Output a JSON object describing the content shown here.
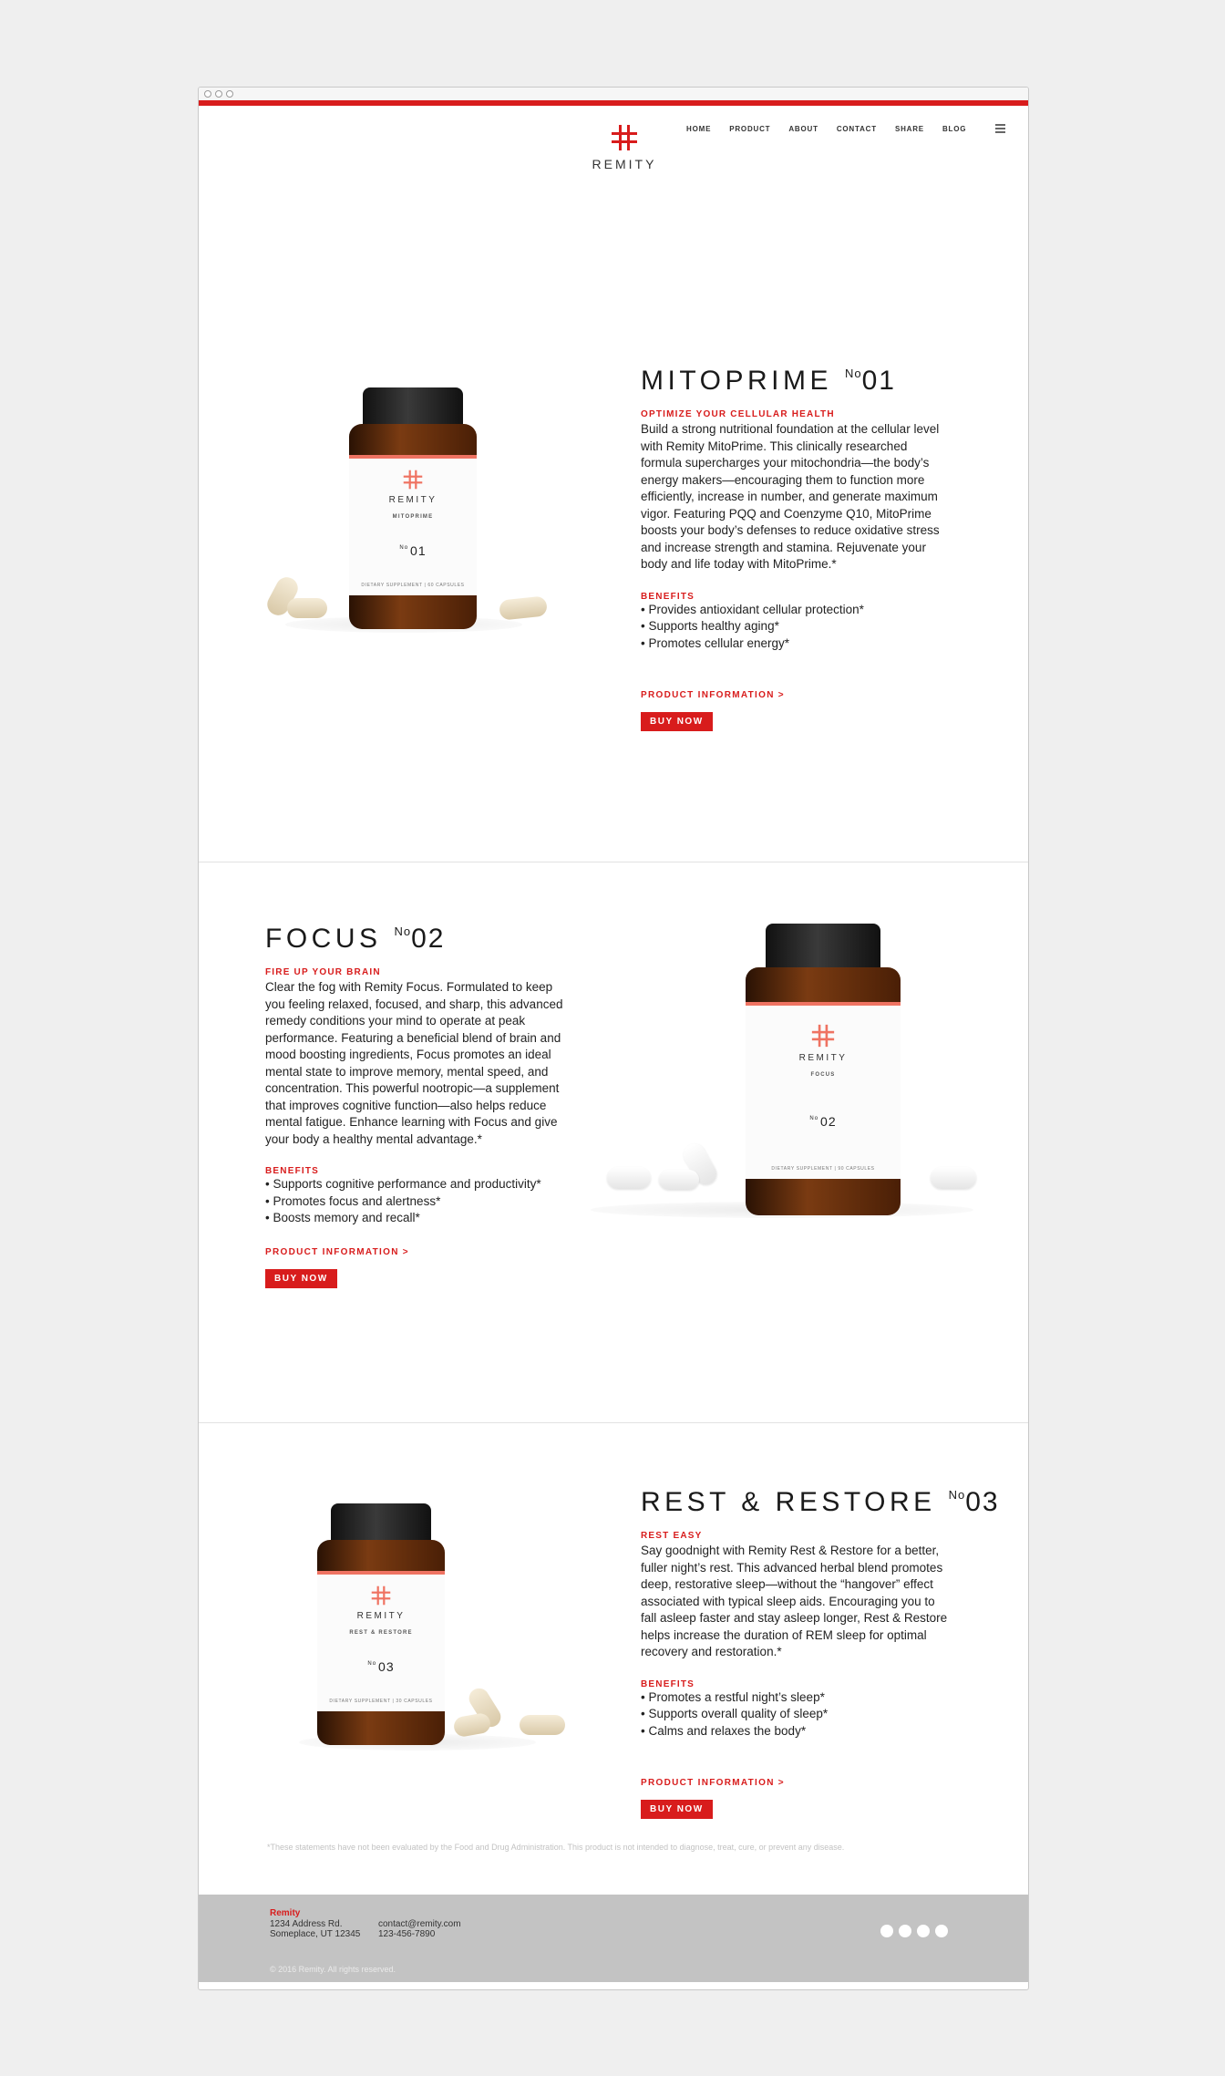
{
  "brand": {
    "name": "REMITY",
    "accent": "#d81c1c",
    "label_accent": "#ef7362"
  },
  "nav": {
    "items": [
      "HOME",
      "PRODUCT",
      "ABOUT",
      "CONTACT",
      "SHARE",
      "BLOG"
    ],
    "menu_icon": "hamburger-icon"
  },
  "products": [
    {
      "name": "MITOPRIME",
      "no_prefix": "No",
      "number": "01",
      "tagline": "OPTIMIZE YOUR CELLULAR HEALTH",
      "description": "Build a strong nutritional foundation at the cellular level with Remity MitoPrime. This clinically researched formula supercharges your mitochondria—the body’s energy makers—encouraging them to function more efficiently, increase in number, and generate maximum vigor. Featuring PQQ and Coenzyme Q10, MitoPrime boosts your body’s defenses to reduce oxidative stress and increase strength and stamina. Rejuvenate your body and life today with MitoPrime.*",
      "benefits_heading": "BENEFITS",
      "benefits": [
        "• Provides antioxidant cellular protection*",
        "• Supports healthy aging*",
        "• Promotes cellular energy*"
      ],
      "product_info_link": "PRODUCT INFORMATION >",
      "buy_label": "BUY NOW",
      "bottle": {
        "brand": "REMITY",
        "product": "MITOPRIME",
        "no": "No",
        "number": "01",
        "fine": "DIETARY SUPPLEMENT | 60 CAPSULES"
      }
    },
    {
      "name": "FOCUS",
      "no_prefix": "No",
      "number": "02",
      "tagline": "FIRE UP YOUR BRAIN",
      "description": "Clear the fog with Remity Focus. Formulated to keep you feeling relaxed, focused, and sharp, this advanced remedy conditions your mind to operate at peak performance. Featuring a beneficial blend of brain and mood boosting ingredients, Focus promotes an ideal mental state to improve memory, mental speed, and concentration. This powerful nootropic—a supplement that improves cognitive function—also helps reduce mental fatigue. Enhance learning with Focus and give your body a healthy mental advantage.*",
      "benefits_heading": "BENEFITS",
      "benefits": [
        "• Supports cognitive performance and productivity*",
        "• Promotes focus and alertness*",
        "• Boosts memory and recall*"
      ],
      "product_info_link": "PRODUCT INFORMATION >",
      "buy_label": "BUY NOW",
      "bottle": {
        "brand": "REMITY",
        "product": "FOCUS",
        "no": "No",
        "number": "02",
        "fine": "DIETARY SUPPLEMENT | 90 CAPSULES"
      }
    },
    {
      "name": "REST & RESTORE",
      "no_prefix": "No",
      "number": "03",
      "tagline": "REST EASY",
      "description": "Say goodnight with Remity Rest & Restore for a better, fuller night’s rest. This advanced herbal blend promotes deep, restorative sleep—without the “hangover” effect associated with typical sleep aids. Encouraging you to fall asleep faster and stay asleep longer, Rest & Restore helps increase the duration of REM sleep for optimal recovery and restoration.*",
      "benefits_heading": "BENEFITS",
      "benefits": [
        "• Promotes a restful night’s sleep*",
        "• Supports overall quality of sleep*",
        "• Calms and relaxes the body*"
      ],
      "product_info_link": "PRODUCT INFORMATION >",
      "buy_label": "BUY NOW",
      "bottle": {
        "brand": "REMITY",
        "product": "REST & RESTORE",
        "no": "No",
        "number": "03",
        "fine": "DIETARY SUPPLEMENT | 30 CAPSULES"
      }
    }
  ],
  "disclaimer": "*These statements have not been evaluated by the Food and Drug Administration. This product is not intended to diagnose, treat, cure, or prevent any disease.",
  "footer": {
    "brand": "Remity",
    "address_line1": "1234 Address Rd.",
    "address_line2": "Someplace, UT 12345",
    "email": "contact@remity.com",
    "phone": "123-456-7890",
    "copyright": "© 2016 Remity. All rights reserved.",
    "social_icons": [
      "social-icon-1",
      "social-icon-2",
      "social-icon-3",
      "social-icon-4"
    ]
  }
}
